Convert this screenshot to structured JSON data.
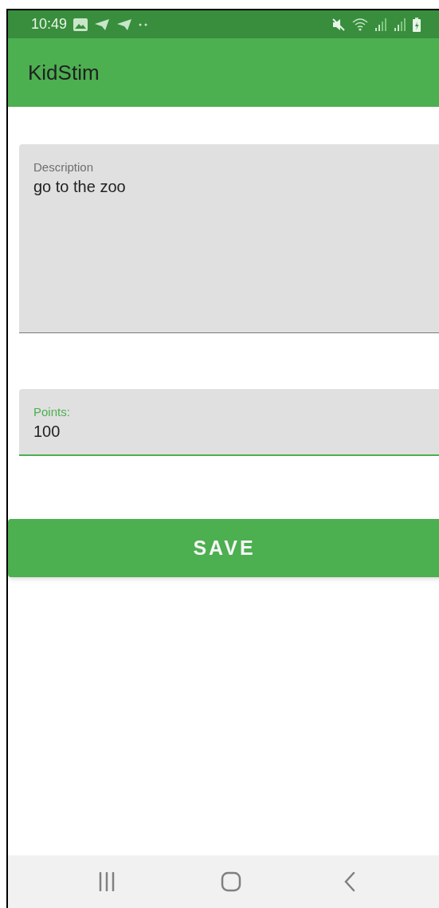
{
  "status_bar": {
    "time": "10:49"
  },
  "app_bar": {
    "title": "KidStim"
  },
  "fields": [
    {
      "kind": "multiline",
      "label": "Description",
      "value": "go to the zoo",
      "focused": false
    },
    {
      "kind": "single",
      "label": "Points:",
      "value": "100",
      "focused": true
    }
  ],
  "save_button": {
    "label": "SAVE"
  }
}
